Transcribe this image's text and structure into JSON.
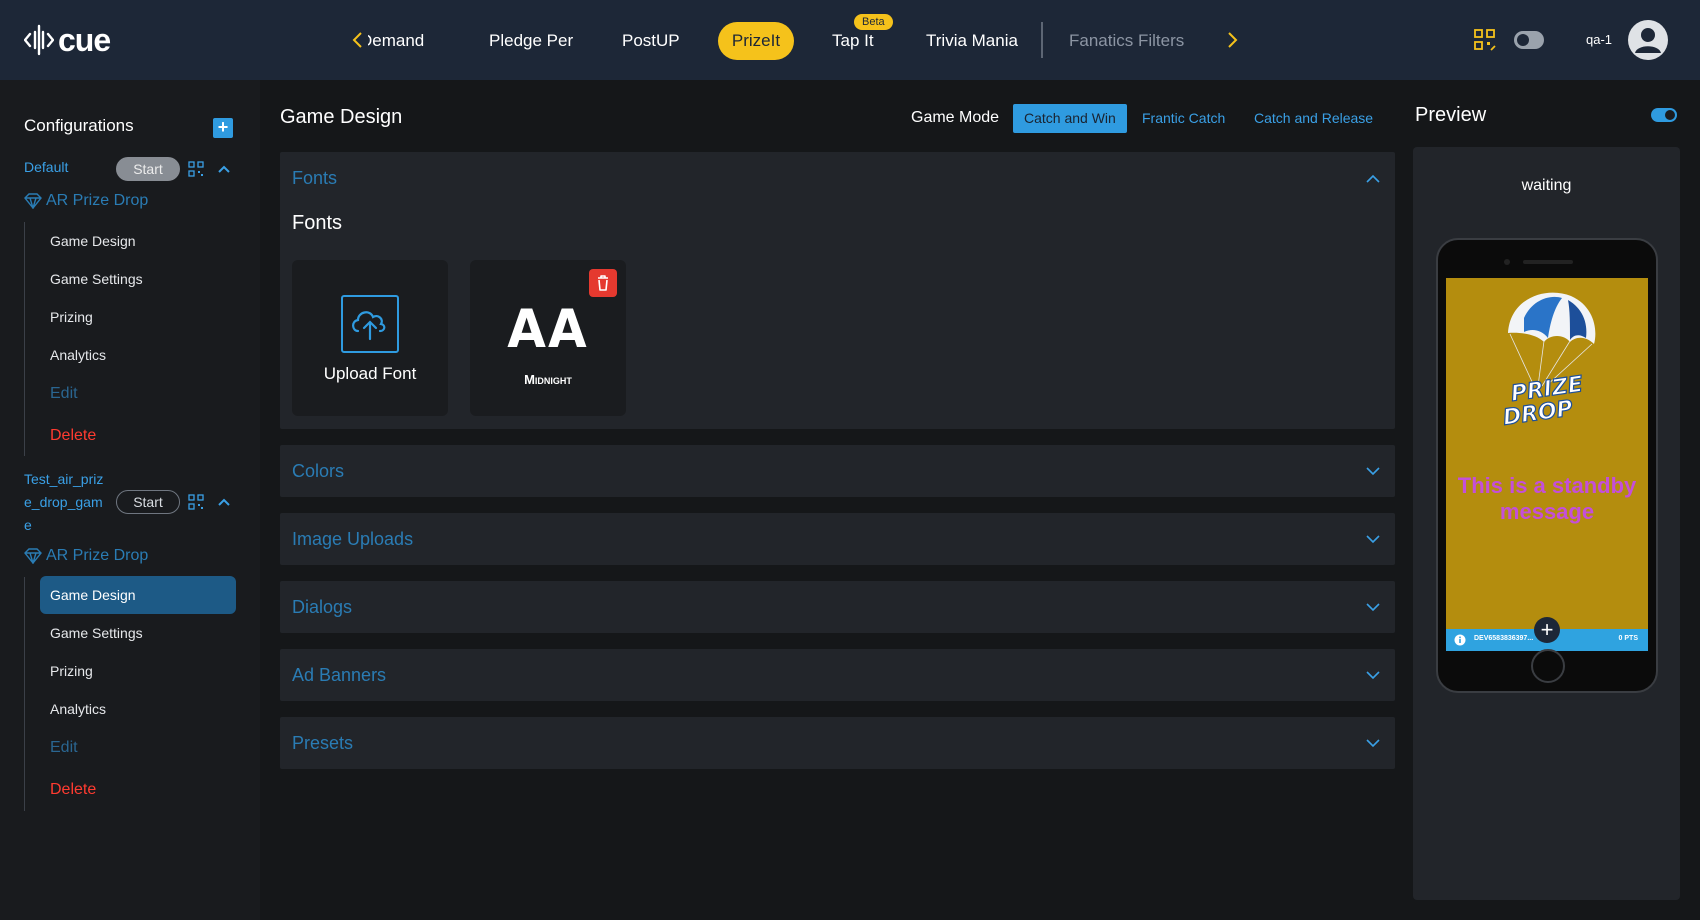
{
  "header": {
    "logo_text": "cue",
    "tabs": [
      {
        "label": "Demand"
      },
      {
        "label": "Pledge Per"
      },
      {
        "label": "PostUP"
      },
      {
        "label": "PrizeIt"
      },
      {
        "label": "Tap It"
      },
      {
        "label": "Trivia Mania"
      },
      {
        "label": "Fanatics Filters"
      }
    ],
    "beta_badge": "Beta",
    "active_tab": "PrizeIt",
    "user_name": "qa-1"
  },
  "sidebar": {
    "title": "Configurations",
    "configs": [
      {
        "name_lines": [
          "Default"
        ],
        "start_label": "Start",
        "type": "AR Prize Drop",
        "items": [
          "Game Design",
          "Game Settings",
          "Prizing",
          "Analytics",
          "Edit",
          "Delete"
        ]
      },
      {
        "name_lines": [
          "Test_air_priz",
          "e_drop_gam",
          "e"
        ],
        "start_label": "Start",
        "type": "AR Prize Drop",
        "items": [
          "Game Design",
          "Game Settings",
          "Prizing",
          "Analytics",
          "Edit",
          "Delete"
        ],
        "active_item": "Game Design"
      }
    ]
  },
  "main": {
    "title": "Game Design",
    "game_mode_label": "Game Mode",
    "game_modes": [
      "Catch and Win",
      "Frantic Catch",
      "Catch and Release"
    ],
    "active_game_mode": "Catch and Win",
    "panels": {
      "fonts": {
        "header": "Fonts",
        "subtitle": "Fonts",
        "upload_label": "Upload Font",
        "font_preview": "AA",
        "font_name": "Midnight"
      },
      "collapsed": [
        "Colors",
        "Image Uploads",
        "Dialogs",
        "Ad Banners",
        "Presets"
      ]
    }
  },
  "preview": {
    "title": "Preview",
    "status": "waiting",
    "screen": {
      "logo_line1": "PRIZE",
      "logo_line2": "DROP",
      "standby_message": "This is a standby message",
      "user_id": "DEV6583836397...",
      "points": "0 PTS",
      "background_color": "#b48d0e",
      "message_color": "#c44fd8"
    }
  },
  "colors": {
    "accent": "#2f9be0",
    "brand_yellow": "#f5c21b",
    "danger": "#ff3b30",
    "header_bg": "#1d2737"
  }
}
